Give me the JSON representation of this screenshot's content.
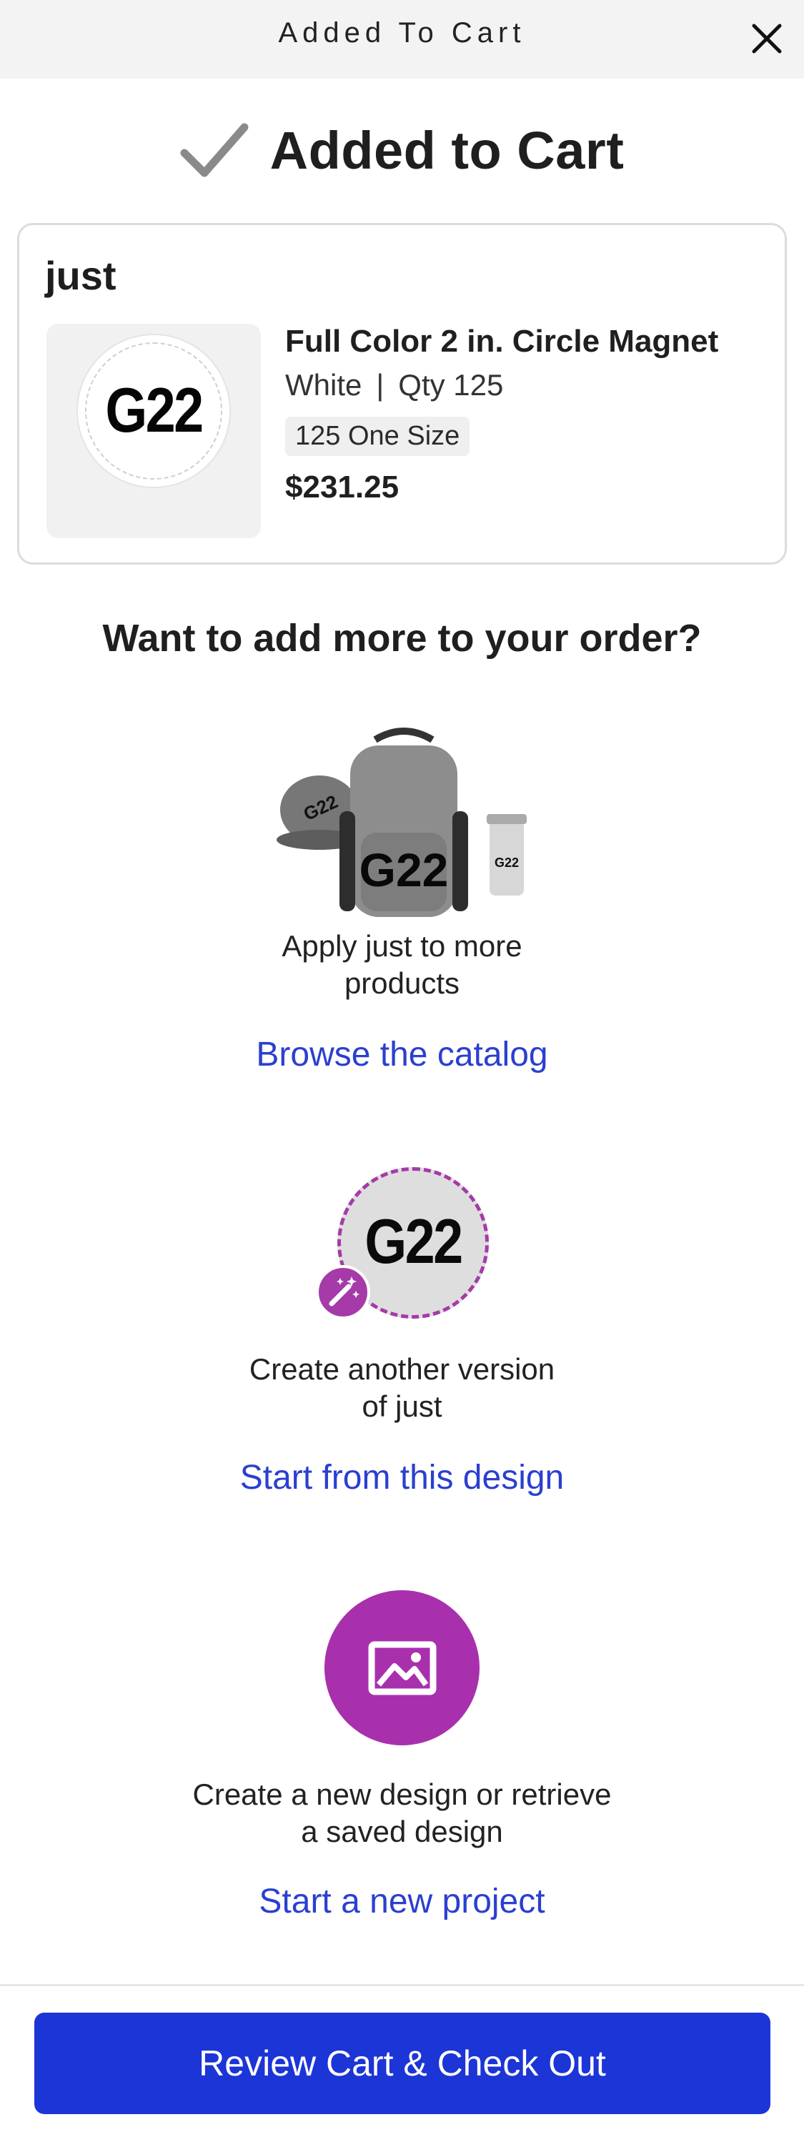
{
  "header": {
    "title": "Added To Cart",
    "close_icon": "close-icon"
  },
  "confirmation": {
    "text": "Added to Cart",
    "icon": "checkmark-icon"
  },
  "cart_item": {
    "design_name": "just",
    "product_name": "Full Color 2 in. Circle Magnet",
    "color": "White",
    "separator": "|",
    "qty_label": "Qty 125",
    "size_label": "125 One Size",
    "price": "$231.25",
    "thumbnail_text": "G22"
  },
  "upsell": {
    "heading": "Want to add more to your order?",
    "sections": [
      {
        "desc_line1": "Apply just to more",
        "desc_line2": "products",
        "link": "Browse the catalog",
        "image_text": "G22",
        "image_text_small": "G22"
      },
      {
        "desc_line1": "Create another version",
        "desc_line2": "of just",
        "link": "Start from this design",
        "image_text": "G22"
      },
      {
        "desc_line1": "Create a new design or retrieve",
        "desc_line2": "a saved design",
        "link": "Start a new project"
      }
    ]
  },
  "cta": {
    "label": "Review Cart & Check Out"
  },
  "colors": {
    "accent_blue": "#1c35d6",
    "link_blue": "#2b3fd0",
    "purple": "#a830ad"
  }
}
